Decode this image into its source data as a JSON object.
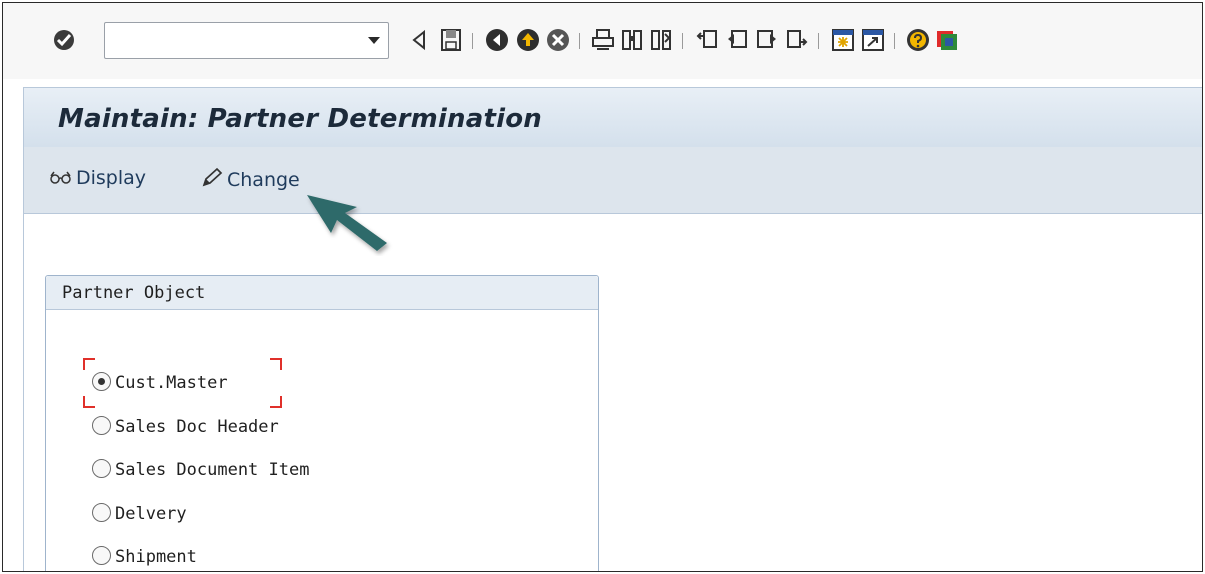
{
  "toolbar": {
    "command_field_value": "",
    "icons": [
      "enter-icon",
      "back-triangle-icon",
      "save-icon",
      "back-icon",
      "exit-icon",
      "cancel-icon",
      "print-icon",
      "find-icon",
      "find-next-icon",
      "first-page-icon",
      "previous-page-icon",
      "next-page-icon",
      "last-page-icon",
      "create-session-icon",
      "shortcut-icon",
      "help-icon",
      "customize-layout-icon"
    ]
  },
  "title": "Maintain: Partner Determination",
  "app_toolbar": {
    "display_label": "Display",
    "change_label": "Change"
  },
  "partner_object": {
    "title": "Partner Object",
    "options": [
      "Cust.Master",
      "Sales Doc Header",
      "Sales Document Item",
      "Delvery",
      "Shipment"
    ],
    "selected": "Cust.Master"
  },
  "colors": {
    "title_bg": "#d4e0ec",
    "title_text": "#1c2a3a",
    "link_text": "#1f3b5c",
    "arrow": "#2f6b6a",
    "focus": "#e0302a"
  }
}
